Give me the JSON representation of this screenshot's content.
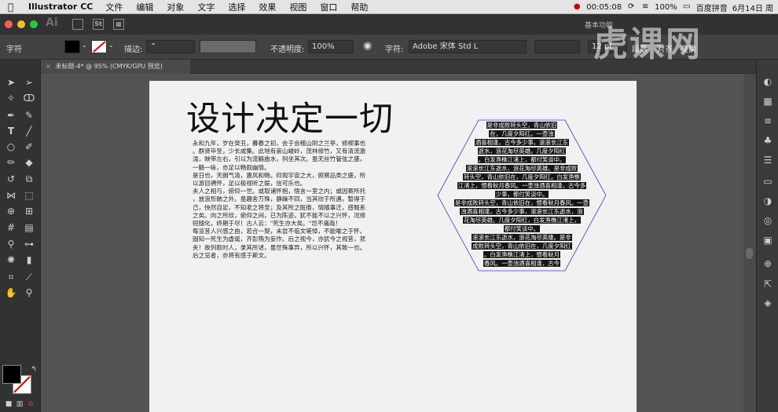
{
  "menubar": {
    "app_name": "Illustrator CC",
    "items": [
      "文件",
      "编辑",
      "对象",
      "文字",
      "选择",
      "效果",
      "视图",
      "窗口",
      "帮助"
    ],
    "clock": "00:05:08",
    "battery": "100%",
    "input_method": "百度拼音",
    "date": "6月14日 周"
  },
  "appbar": {
    "ai_badge": "Ai",
    "st_badge": "St",
    "workspace": "基本功能"
  },
  "control": {
    "object_type": "字符",
    "stroke_label": "描边:",
    "opacity_label": "不透明度:",
    "opacity_value": "100%",
    "char_label": "字符:",
    "font_name": "Adobe 宋体 Std L",
    "font_size": "12 pt",
    "paragraph_label": "段落",
    "align_label": "对齐",
    "transform_label": "变换"
  },
  "document": {
    "tab_title": "未标题-4* @ 95% (CMYK/GPU 预览)"
  },
  "artboard": {
    "headline": "设计决定一切",
    "body_lines": [
      "永和九年，岁在癸丑，暮春之初，会于会稽山阴之兰亭，修禊事也",
      "。群贤毕至，少长咸集。此地有崇山峻岭，茂林修竹，又有清流激",
      "湍，映带左右，引以为流觞曲水，列坐其次。虽无丝竹管弦之盛，",
      "一觞一咏，亦足以畅叙幽情。",
      "是日也，天朗气清，惠风和畅。仰观宇宙之大，俯察品类之盛，所",
      "以游目骋怀，足以极视听之娱，信可乐也。",
      "夫人之相与，俯仰一世。或取诸怀抱，悟言一室之内；或因寄所托",
      "，放浪形骸之外。虽趣舍万殊，静躁不同，当其欣于所遇，暂得于",
      "己，快然自足，不知老之将至；及其所之既倦，情随事迁，感慨系",
      "之矣。向之所欣，俯仰之间，已为陈迹，犹不能不以之兴怀，况修",
      "短随化，终期于尽！古人云：\"死生亦大矣。\"岂不痛哉！",
      "每览昔人兴感之由，若合一契，未尝不临文嗟悼，不能喻之于怀。",
      "固知一死生为虚诞，齐彭殇为妄作。后之视今，亦犹今之视昔，悲",
      "夫！故列叙时人，录其所述，虽世殊事异，所以兴怀，其致一也。",
      "后之览者，亦将有感于斯文。"
    ],
    "hex_lines": [
      "是非成败转头空，青山依旧",
      "在，几度夕阳红。一壶浊",
      "酒喜相逢，古今多少事，滚滚长江东",
      "逝水，浪花淘尽英雄。几度夕阳红",
      "。白发渔樵江渚上，都付笑谈中。",
      "滚滚长江东逝水，浪花淘尽英雄。是非成败",
      "转头空，青山依旧在，几度夕阳红。白发渔樵",
      "江渚上，惯看秋月春风。一壶浊酒喜相逢，古今多",
      "少事，都付笑谈中。",
      "是非成败转头空，青山依旧在，惯看秋月春风。一壶",
      "浊酒喜相逢，古今多少事，滚滚长江东逝水，浪",
      "花淘尽英雄。几度夕阳红，白发渔樵江渚上，",
      "都付笑谈中。",
      "滚滚长江东逝水，浪花淘尽英雄。是非",
      "成败转头空，青山依旧在，几度夕阳红",
      "。白发渔樵江渚上，惯看秋月",
      "春风。一壶浊酒喜相逢，古今"
    ]
  },
  "watermark": "虎课网"
}
